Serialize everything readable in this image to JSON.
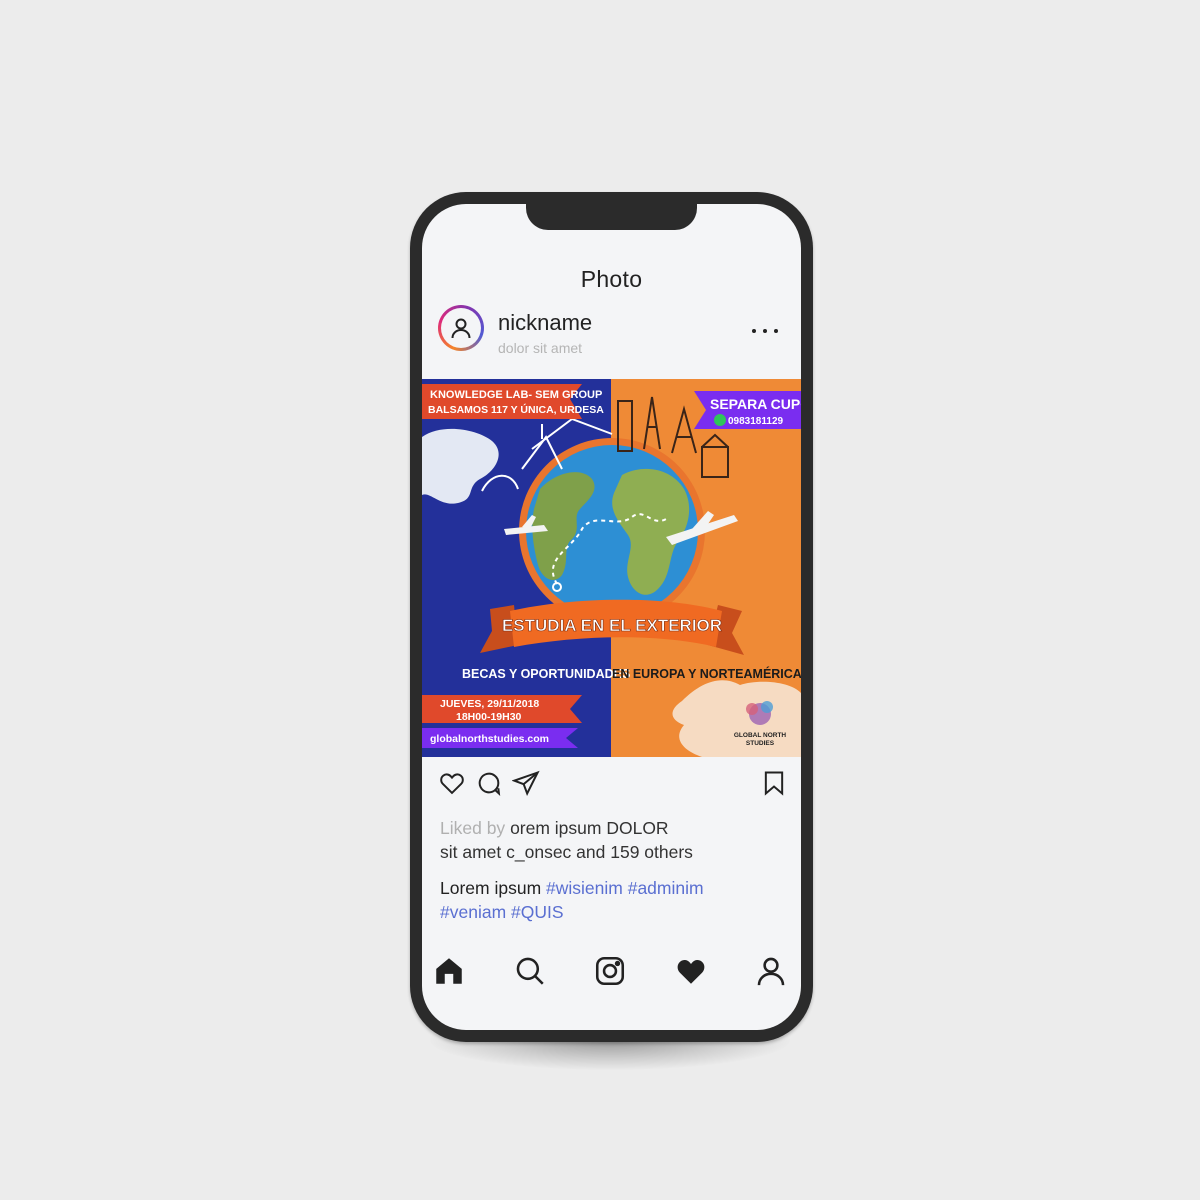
{
  "screen": {
    "title": "Photo"
  },
  "post_header": {
    "nickname": "nickname",
    "subtitle": "dolor sit amet",
    "avatar_icon": "user-icon",
    "more_icon": "more-dots-icon"
  },
  "post_image": {
    "top_left_line1": "KNOWLEDGE LAB- SEM GROUP",
    "top_left_line2": "BALSAMOS 117 Y ÚNICA, URDESA",
    "top_right_title": "SEPARA CUPO",
    "top_right_phone": "0983181129",
    "banner": "ESTUDIA EN EL EXTERIOR",
    "subline_left": "BECAS Y OPORTUNIDADES",
    "subline_right": "EN EUROPA Y NORTEAMÉRICA",
    "date": "JUEVES, 29/11/2018",
    "time": "18H00-19H30",
    "website": "globalnorthstudies.com",
    "logo_line1": "GLOBAL NORTH",
    "logo_line2": "STUDIES",
    "colors": {
      "blue": "#23309a",
      "orange": "#ef8a36",
      "red": "#e0492b",
      "purple": "#7a2df0"
    }
  },
  "actions": {
    "like_icon": "heart-outline-icon",
    "comment_icon": "comment-icon",
    "share_icon": "send-icon",
    "save_icon": "bookmark-icon"
  },
  "likes": {
    "prefix": "Liked by",
    "names_line1": "orem ipsum DOLOR",
    "line2": "sit amet c_onsec and 159 others"
  },
  "caption": {
    "text": "Lorem ipsum",
    "tags_line1": "#wisienim #adminim",
    "tags_line2": "#veniam #QUIS"
  },
  "tabbar": {
    "home": "home-icon",
    "search": "search-icon",
    "camera": "instagram-camera-icon",
    "activity": "heart-filled-icon",
    "profile": "profile-icon"
  }
}
